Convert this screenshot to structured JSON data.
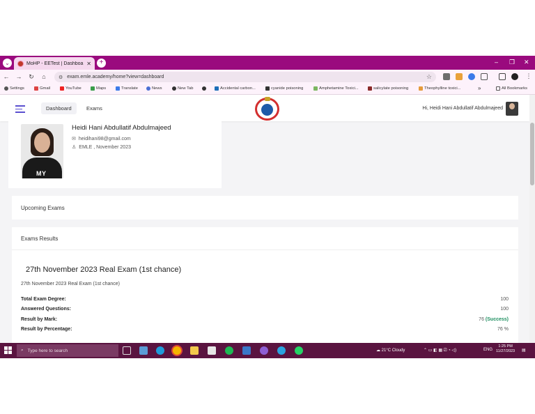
{
  "browser": {
    "tab_title": "MoHP - EETest | Dashboard",
    "url": "exam.emle.academy/home?view=dashboard",
    "bookmarks": [
      "Settings",
      "Gmail",
      "YouTube",
      "Maps",
      "Translate",
      "News",
      "New Tab",
      "Accidental carbon...",
      "cyanide poisoning",
      "Amphetamine Toxici...",
      "salicylate poisoning",
      "Theophylline toxici...",
      "All Bookmarks"
    ]
  },
  "header": {
    "nav": [
      "Dashboard",
      "Exams"
    ],
    "greeting": "Hi,  Heidi Hani Abdullatif Abdulmajeed"
  },
  "profile": {
    "name": "Heidi Hani Abdullatif Abdulmajeed",
    "email": "heidihani98@gmail.com",
    "meta": "EMLE , November 2023",
    "shirt_text": "MY"
  },
  "upcoming": {
    "title": "Upcoming Exams"
  },
  "results": {
    "title": "Exams Results",
    "exam_title": "27th November 2023 Real Exam (1st chance)",
    "exam_subtitle": "27th November 2023 Real Exam (1st chance)",
    "rows": [
      {
        "label": "Total Exam Degree:",
        "value": "100"
      },
      {
        "label": "Answered Questions:",
        "value": "100"
      },
      {
        "label": "Result by Mark:",
        "value": "76",
        "status": "(Success)"
      },
      {
        "label": "Result by Percentage:",
        "value": "76 %"
      }
    ]
  },
  "taskbar": {
    "search_placeholder": "Type here to search",
    "weather": "21°C  Cloudy",
    "lang": "ENG",
    "time": "1:25 PM",
    "date": "11/27/2023"
  },
  "colors": {
    "chrome": "#9a0a7e",
    "taskbar": "#5a1440",
    "success": "#1e8f60",
    "accent": "#5a4fcf"
  }
}
